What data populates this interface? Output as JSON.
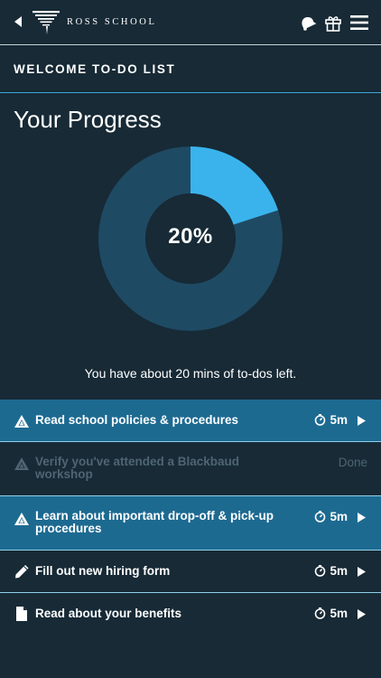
{
  "header": {
    "logo_text": "ROSS SCHOOL",
    "icons": [
      "back-arrow-icon",
      "ross-logo-icon",
      "bell-icon",
      "gift-icon",
      "hamburger-menu-icon"
    ]
  },
  "section": {
    "title": "WELCOME TO-DO LIST"
  },
  "progress": {
    "title": "Your Progress",
    "percent_label": "20%",
    "fraction": 0.2,
    "remaining_text": "You have about 20 mins of to-dos left."
  },
  "colors": {
    "background": "#172a36",
    "donut_track": "#1f4a63",
    "donut_fill": "#3ab3ec",
    "active_row": "#1d6a91",
    "divider": "#8fd0ea"
  },
  "todos": [
    {
      "label": "Read school policies & procedures",
      "time": "5m",
      "status": "active",
      "icon": "triangle-warning-icon"
    },
    {
      "label": "Verify you've attended a Blackbaud workshop",
      "status_text": "Done",
      "status": "done",
      "icon": "triangle-warning-icon"
    },
    {
      "label": "Learn about important drop-off & pick-up procedures",
      "time": "5m",
      "status": "active",
      "icon": "triangle-warning-icon"
    },
    {
      "label": "Fill out new hiring form",
      "time": "5m",
      "status": "pending",
      "icon": "pencil-icon"
    },
    {
      "label": "Read about your benefits",
      "time": "5m",
      "status": "pending",
      "icon": "document-icon"
    }
  ]
}
